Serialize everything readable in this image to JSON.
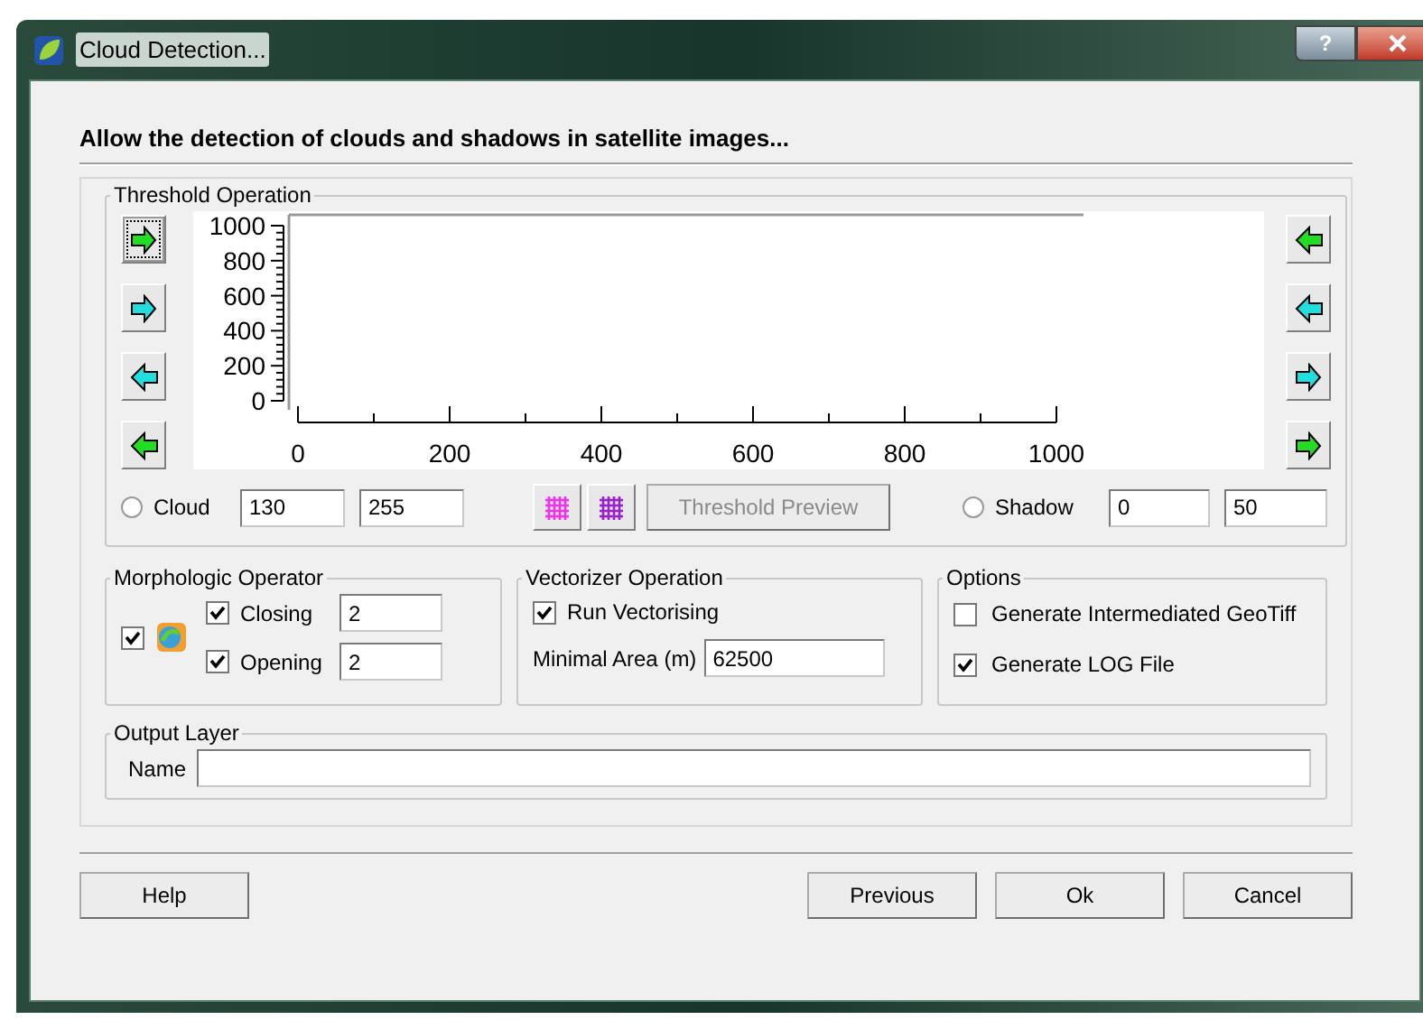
{
  "window": {
    "title": "Cloud Detection...",
    "help_glyph": "?"
  },
  "heading": "Allow the detection of clouds and shadows in satellite images...",
  "threshold": {
    "title": "Threshold Operation",
    "left_buttons": [
      {
        "kind": "right",
        "color": "#22dd22",
        "focused": true
      },
      {
        "kind": "right",
        "color": "#22dddd",
        "focused": false
      },
      {
        "kind": "left",
        "color": "#22dddd",
        "focused": false
      },
      {
        "kind": "left",
        "color": "#22dd22",
        "focused": false
      }
    ],
    "right_buttons": [
      {
        "kind": "left",
        "color": "#22dd22",
        "focused": false
      },
      {
        "kind": "left",
        "color": "#22dddd",
        "focused": false
      },
      {
        "kind": "right",
        "color": "#22dddd",
        "focused": false
      },
      {
        "kind": "right",
        "color": "#22dd22",
        "focused": false
      }
    ],
    "chart_data": {
      "type": "line",
      "xlim": [
        0,
        1000
      ],
      "ylim": [
        0,
        1000
      ],
      "xticks": [
        0,
        200,
        400,
        600,
        800,
        1000
      ],
      "yticks": [
        0,
        200,
        400,
        600,
        800,
        1000
      ]
    },
    "cloud": {
      "label": "Cloud",
      "selected": false,
      "min": "130",
      "max": "255"
    },
    "grid_buttons": [
      {
        "color": "#ee33ee"
      },
      {
        "color": "#9922cc"
      }
    ],
    "preview_button": {
      "label": "Threshold Preview",
      "disabled": true
    },
    "shadow": {
      "label": "Shadow",
      "selected": false,
      "min": "0",
      "max": "50"
    }
  },
  "morphologic": {
    "title": "Morphologic Operator",
    "enabled": true,
    "items": [
      {
        "label": "Closing",
        "checked": true,
        "value": "2"
      },
      {
        "label": "Opening",
        "checked": true,
        "value": "2"
      }
    ]
  },
  "vectorizer": {
    "title": "Vectorizer Operation",
    "run": {
      "label": "Run Vectorising",
      "checked": true
    },
    "area_label": "Minimal Area (m)",
    "area_value": "62500"
  },
  "options": {
    "title": "Options",
    "items": [
      {
        "label": "Generate Intermediated GeoTiff",
        "checked": false
      },
      {
        "label": "Generate LOG File",
        "checked": true
      }
    ]
  },
  "output": {
    "title": "Output Layer",
    "name_label": "Name"
  },
  "buttons": [
    {
      "label": "Help",
      "kind": "left"
    },
    {
      "label": "Previous",
      "kind": "right"
    },
    {
      "label": "Ok",
      "kind": "right"
    },
    {
      "label": "Cancel",
      "kind": "right"
    }
  ]
}
